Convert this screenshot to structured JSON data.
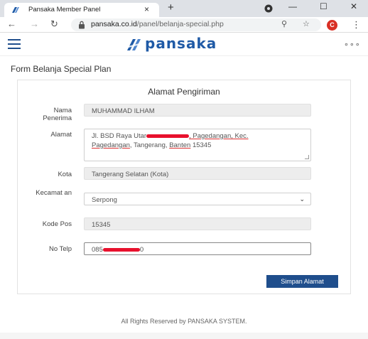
{
  "browser": {
    "tab_title": "Pansaka Member Panel",
    "tab_close": "×",
    "new_tab": "+",
    "window_minimize": "—",
    "window_maximize": "☐",
    "window_close": "✕",
    "url_host": "pansaka.co.id",
    "url_path": "/panel/belanja-special.php",
    "profile_initial": "C"
  },
  "site": {
    "logo_text": "pansaka",
    "brand_color": "#1f5aa6"
  },
  "page": {
    "title": "Form Belanja Special Plan",
    "card_title": "Alamat Pengiriman"
  },
  "form": {
    "nama_label": "Nama Penerima",
    "nama_value": "MUHAMMAD ILHAM",
    "alamat_label": "Alamat",
    "alamat_prefix": "Jl. BSD Raya Utar",
    "alamat_rest_1": ", Pagedangan, Kec.",
    "alamat_line2_a": "Pagedangan",
    "alamat_line2_b": ", Tangerang, ",
    "alamat_line2_c": "Banten",
    "alamat_line2_d": " 15345",
    "kota_label": "Kota",
    "kota_value": "Tangerang Selatan (Kota)",
    "kecamatan_label": "Kecamat an",
    "kecamatan_value": "Serpong",
    "kodepos_label": "Kode Pos",
    "kodepos_value": "15345",
    "notelp_label": "No Telp",
    "notelp_prefix": "085",
    "notelp_suffix": "0",
    "save_label": "Simpan Alamat",
    "save_color": "#1f4e8c"
  },
  "footer": {
    "text": "All Rights Reserved by PANSAKA SYSTEM."
  }
}
